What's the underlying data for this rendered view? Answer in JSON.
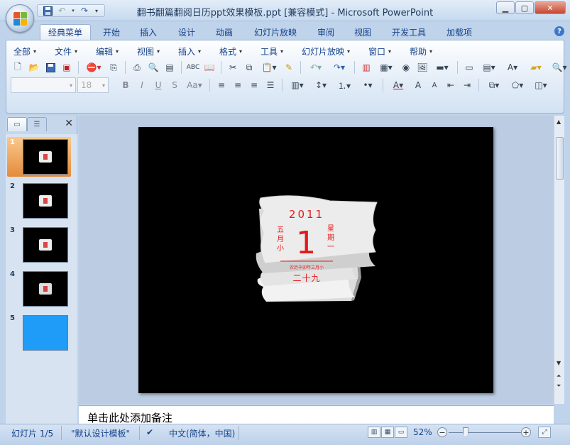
{
  "window": {
    "title": "翻书翻篇翻阅日历ppt效果模板.ppt [兼容模式] - Microsoft PowerPoint"
  },
  "ribbon": {
    "tabs": [
      {
        "label": "经典菜单",
        "active": true
      },
      {
        "label": "开始"
      },
      {
        "label": "插入"
      },
      {
        "label": "设计"
      },
      {
        "label": "动画"
      },
      {
        "label": "幻灯片放映"
      },
      {
        "label": "审阅"
      },
      {
        "label": "视图"
      },
      {
        "label": "开发工具"
      },
      {
        "label": "加载项"
      }
    ],
    "menus": [
      "全部",
      "文件",
      "编辑",
      "视图",
      "插入",
      "格式",
      "工具",
      "幻灯片放映",
      "窗口",
      "帮助"
    ],
    "font_size": "18",
    "font_name": ""
  },
  "slides_panel": {
    "thumbnails": [
      {
        "number": "1",
        "type": "calendar",
        "selected": true
      },
      {
        "number": "2",
        "type": "calendar"
      },
      {
        "number": "3",
        "type": "calendar"
      },
      {
        "number": "4",
        "type": "calendar"
      },
      {
        "number": "5",
        "type": "blue"
      }
    ]
  },
  "slide": {
    "year": "2011",
    "day": "1",
    "month_text": [
      "五",
      "月",
      "小"
    ],
    "week_text": [
      "星",
      "期",
      "一"
    ],
    "lunar_small": "农历辛卯年三月小",
    "lunar_day": "二十九",
    "colors": {
      "background": "#000000",
      "accent": "#e21a1a"
    }
  },
  "notes": {
    "placeholder": "单击此处添加备注"
  },
  "status_bar": {
    "slide_info": "幻灯片 1/5",
    "theme": "\"默认设计模板\"",
    "language": "中文(简体，中国)",
    "zoom": "52%",
    "zoom_fraction": 0.52
  }
}
